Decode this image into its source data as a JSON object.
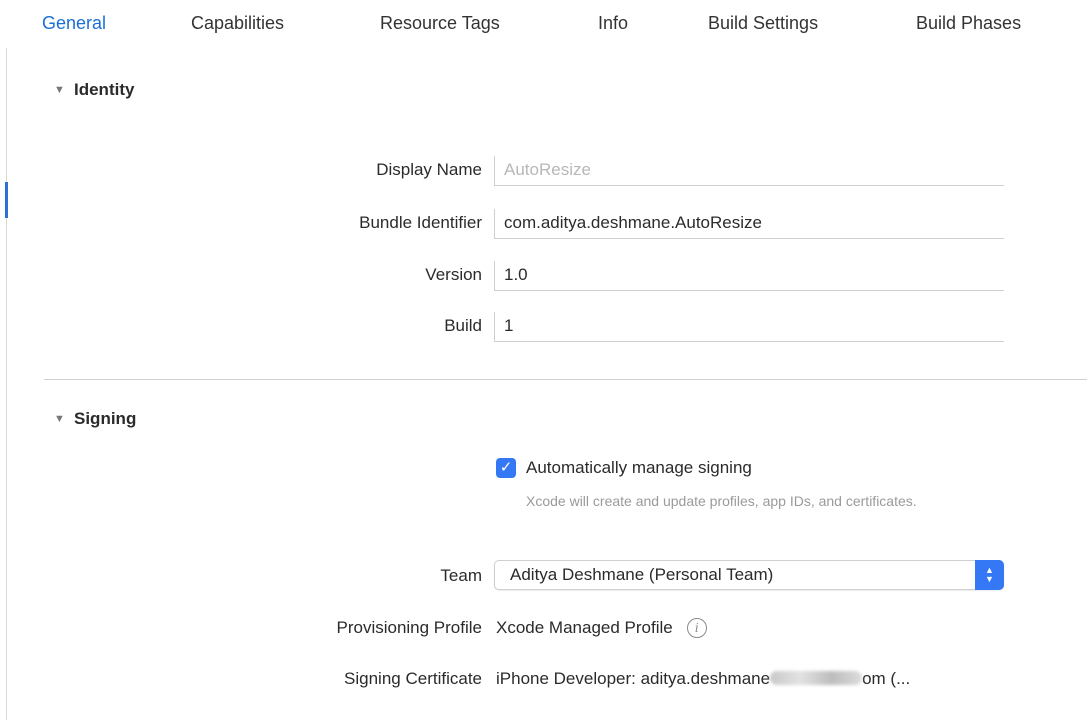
{
  "tabs": [
    {
      "label": "General",
      "active": true
    },
    {
      "label": "Capabilities",
      "active": false
    },
    {
      "label": "Resource Tags",
      "active": false
    },
    {
      "label": "Info",
      "active": false
    },
    {
      "label": "Build Settings",
      "active": false
    },
    {
      "label": "Build Phases",
      "active": false
    }
  ],
  "identity": {
    "header": "Identity",
    "display_name_label": "Display Name",
    "display_name_placeholder": "AutoResize",
    "bundle_id_label": "Bundle Identifier",
    "bundle_id_value": "com.aditya.deshmane.AutoResize",
    "version_label": "Version",
    "version_value": "1.0",
    "build_label": "Build",
    "build_value": "1"
  },
  "signing": {
    "header": "Signing",
    "auto_manage_label": "Automatically manage signing",
    "auto_manage_checked": true,
    "auto_manage_help": "Xcode will create and update profiles, app IDs, and certificates.",
    "team_label": "Team",
    "team_value": "Aditya Deshmane (Personal Team)",
    "profile_label": "Provisioning Profile",
    "profile_value": "Xcode Managed Profile",
    "certificate_label": "Signing Certificate",
    "certificate_value_prefix": "iPhone Developer: aditya.deshmane",
    "certificate_value_suffix": "om (..."
  },
  "colors": {
    "accent": "#3478f6",
    "active_tab": "#1a6fd6"
  },
  "icons": {
    "disclosure": "disclosure-triangle-icon",
    "checkbox": "checkmark-icon",
    "popup": "popup-arrows-icon",
    "info": "info-circle-icon"
  }
}
